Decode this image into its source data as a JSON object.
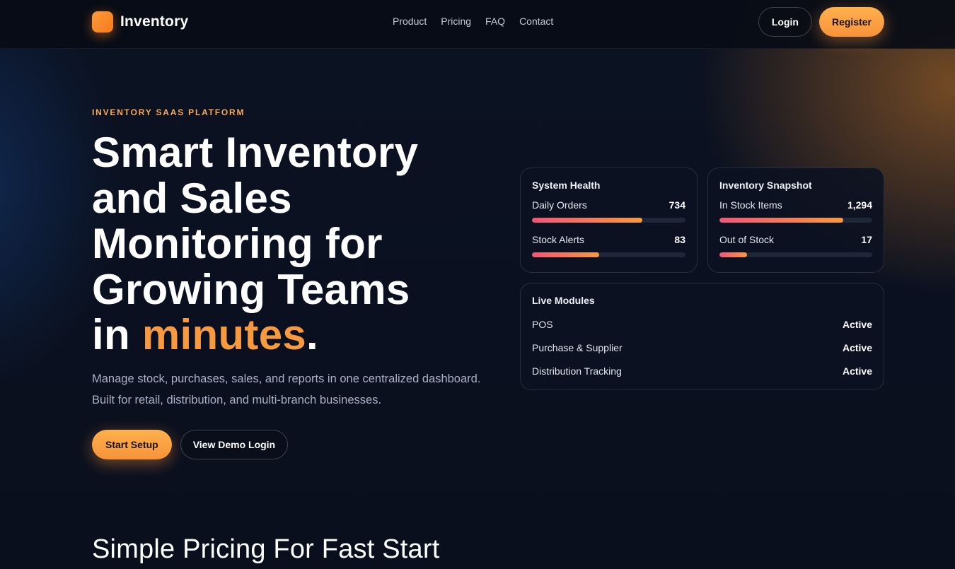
{
  "app": {
    "brand_name": "Inventory",
    "logo_icon": "inventory-logo-icon"
  },
  "nav": {
    "items": [
      {
        "label": "Product"
      },
      {
        "label": "Pricing"
      },
      {
        "label": "FAQ"
      },
      {
        "label": "Contact"
      }
    ]
  },
  "header": {
    "login_label": "Login",
    "register_label": "Register"
  },
  "hero": {
    "eyebrow": "INVENTORY SAAS PLATFORM",
    "title_line1": "Smart Inventory",
    "title_line2": "and Sales",
    "title_line3": "Monitoring for",
    "title_line4": "Growing Teams",
    "title_line5_prefix": "in ",
    "title_accent": "minutes",
    "title_suffix": ".",
    "subtitle_line1": "Manage stock, purchases, sales, and reports in one centralized dashboard.",
    "subtitle_line2": "Built for retail, distribution, and multi-branch businesses.",
    "primary_cta": "Start Setup",
    "secondary_cta": "View Demo Login"
  },
  "system_health": {
    "title": "System Health",
    "metrics": [
      {
        "label": "Daily Orders",
        "value": "734",
        "progress": 0.72
      },
      {
        "label": "Stock Alerts",
        "value": "83",
        "progress": 0.44
      }
    ]
  },
  "inventory_snapshot": {
    "title": "Inventory Snapshot",
    "metrics": [
      {
        "label": "In Stock Items",
        "value": "1,294",
        "progress": 0.81
      },
      {
        "label": "Out of Stock",
        "value": "17",
        "progress": 0.18
      }
    ]
  },
  "live_modules": {
    "title": "Live Modules",
    "items": [
      {
        "label": "POS",
        "status": "Active"
      },
      {
        "label": "Purchase & Supplier",
        "status": "Active"
      },
      {
        "label": "Distribution Tracking",
        "status": "Active"
      }
    ]
  },
  "pricing_section": {
    "title": "Simple Pricing For Fast Start"
  },
  "colors": {
    "accent": "#f7993f",
    "bar_gradient_start": "#f2567a",
    "bar_gradient_end": "#f7993f",
    "background": "#0a1020"
  }
}
